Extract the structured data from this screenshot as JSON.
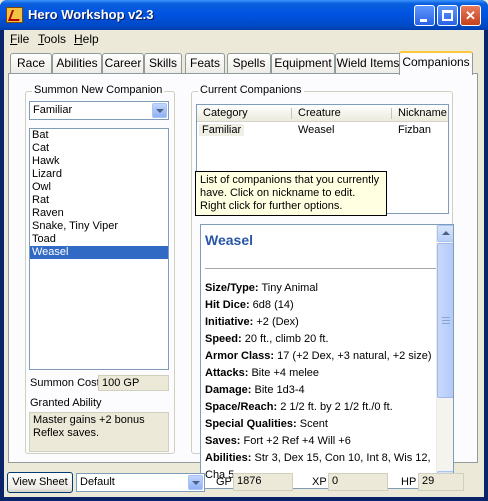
{
  "window": {
    "title": "Hero Workshop v2.3"
  },
  "colors": {
    "title_bar": "#0054e3",
    "selection": "#316ac5",
    "tooltip": "#ffffe1",
    "creature_name": "#2a56a8",
    "active_tab_accent": "#ffc83c"
  },
  "menu": {
    "items": [
      {
        "label": "File",
        "key": "F"
      },
      {
        "label": "Tools",
        "key": "T"
      },
      {
        "label": "Help",
        "key": "H"
      }
    ]
  },
  "tabs": [
    "Race",
    "Abilities",
    "Career",
    "Skills",
    "Feats",
    "Spells",
    "Equipment",
    "Wield Items",
    "Companions"
  ],
  "active_tab": "Companions",
  "summon": {
    "group_label": "Summon New Companion",
    "type_value": "Familiar",
    "creatures": [
      "Bat",
      "Cat",
      "Hawk",
      "Lizard",
      "Owl",
      "Rat",
      "Raven",
      "Snake, Tiny Viper",
      "Toad",
      "Weasel"
    ],
    "selected": "Weasel",
    "cost_label": "Summon Cost",
    "cost_value": "100 GP",
    "granted_label": "Granted Ability",
    "granted_text": "Master gains +2 bonus Reflex saves."
  },
  "current": {
    "group_label": "Current Companions",
    "columns": [
      "Category",
      "Creature",
      "Nickname"
    ],
    "rows": [
      {
        "category": "Familiar",
        "creature": "Weasel",
        "nickname": "Fizban"
      }
    ]
  },
  "tooltip": "List of companions that you currently have. Click on nickname to edit. Right click for further options.",
  "detail": {
    "name": "Weasel",
    "stats": [
      {
        "label": "Size/Type:",
        "value": " Tiny Animal"
      },
      {
        "label": "Hit Dice:",
        "value": " 6d8 (14)"
      },
      {
        "label": "Initiative:",
        "value": " +2 (Dex)"
      },
      {
        "label": "Speed:",
        "value": " 20 ft., climb 20 ft."
      },
      {
        "label": "Armor Class:",
        "value": " 17 (+2 Dex, +3 natural, +2 size)"
      },
      {
        "label": "Attacks:",
        "value": " Bite +4 melee"
      },
      {
        "label": "Damage:",
        "value": " Bite 1d3-4"
      },
      {
        "label": "Space/Reach:",
        "value": " 2 1/2 ft. by 2 1/2 ft./0 ft."
      },
      {
        "label": "Special Qualities:",
        "value": " Scent"
      },
      {
        "label": "Saves:",
        "value": " Fort +2 Ref +4 Will +6"
      },
      {
        "label": "Abilities:",
        "value": " Str 3, Dex 15, Con 10, Int 8, Wis 12, Cha 5"
      }
    ]
  },
  "bottom": {
    "view_sheet": "View Sheet",
    "sheet_value": "Default",
    "gp_label": "GP",
    "gp_value": "1876",
    "xp_label": "XP",
    "xp_value": "0",
    "hp_label": "HP",
    "hp_value": "29"
  }
}
